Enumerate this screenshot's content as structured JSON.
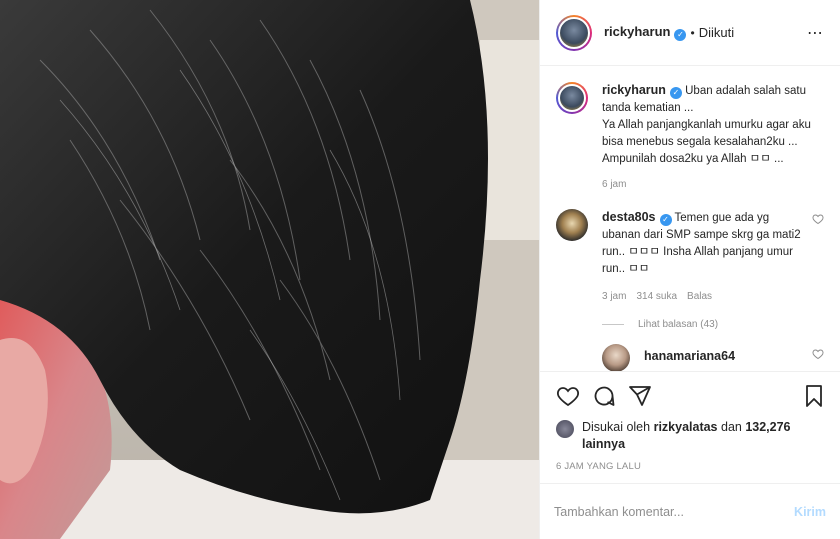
{
  "photo": {
    "alt": ""
  },
  "header": {
    "username": "rickyharun",
    "verified_mark": "✓",
    "separator": "•",
    "follow_status": "Diikuti",
    "more": "⋯"
  },
  "caption": {
    "username": "rickyharun",
    "text": "Uban adalah salah satu tanda kematian ...\nYa Allah panjangkanlah umurku agar aku bisa menebus segala kesalahan2ku ...\nAmpunilah dosa2ku ya Allah ㅁㅁ ...",
    "time": "6 jam"
  },
  "comments": [
    {
      "username": "desta80s",
      "text": "Temen gue ada yg ubanan dari SMP sampe skrg ga mati2 run.. ㅁㅁㅁ Insha Allah panjang umur run.. ㅁㅁ",
      "time": "3 jam",
      "likes": "314 suka",
      "reply": "Balas",
      "view_replies": "Lihat balasan (43)"
    },
    {
      "username": "hanamariana64",
      "text": ""
    }
  ],
  "actions": {
    "like": "heart-icon",
    "comment": "comment-icon",
    "share": "share-icon",
    "save": "bookmark-icon"
  },
  "likes": {
    "prefix": "Disukai oleh ",
    "user": "rizkyalatas",
    "middle": " dan ",
    "count": "132,276 lainnya"
  },
  "timestamp": "6 JAM YANG LALU",
  "add_comment": {
    "placeholder": "Tambahkan komentar...",
    "post_label": "Kirim"
  },
  "colors": {
    "verified": "#3897f0",
    "post_button_disabled": "#b3dbff",
    "muted": "#8e8e8e"
  }
}
